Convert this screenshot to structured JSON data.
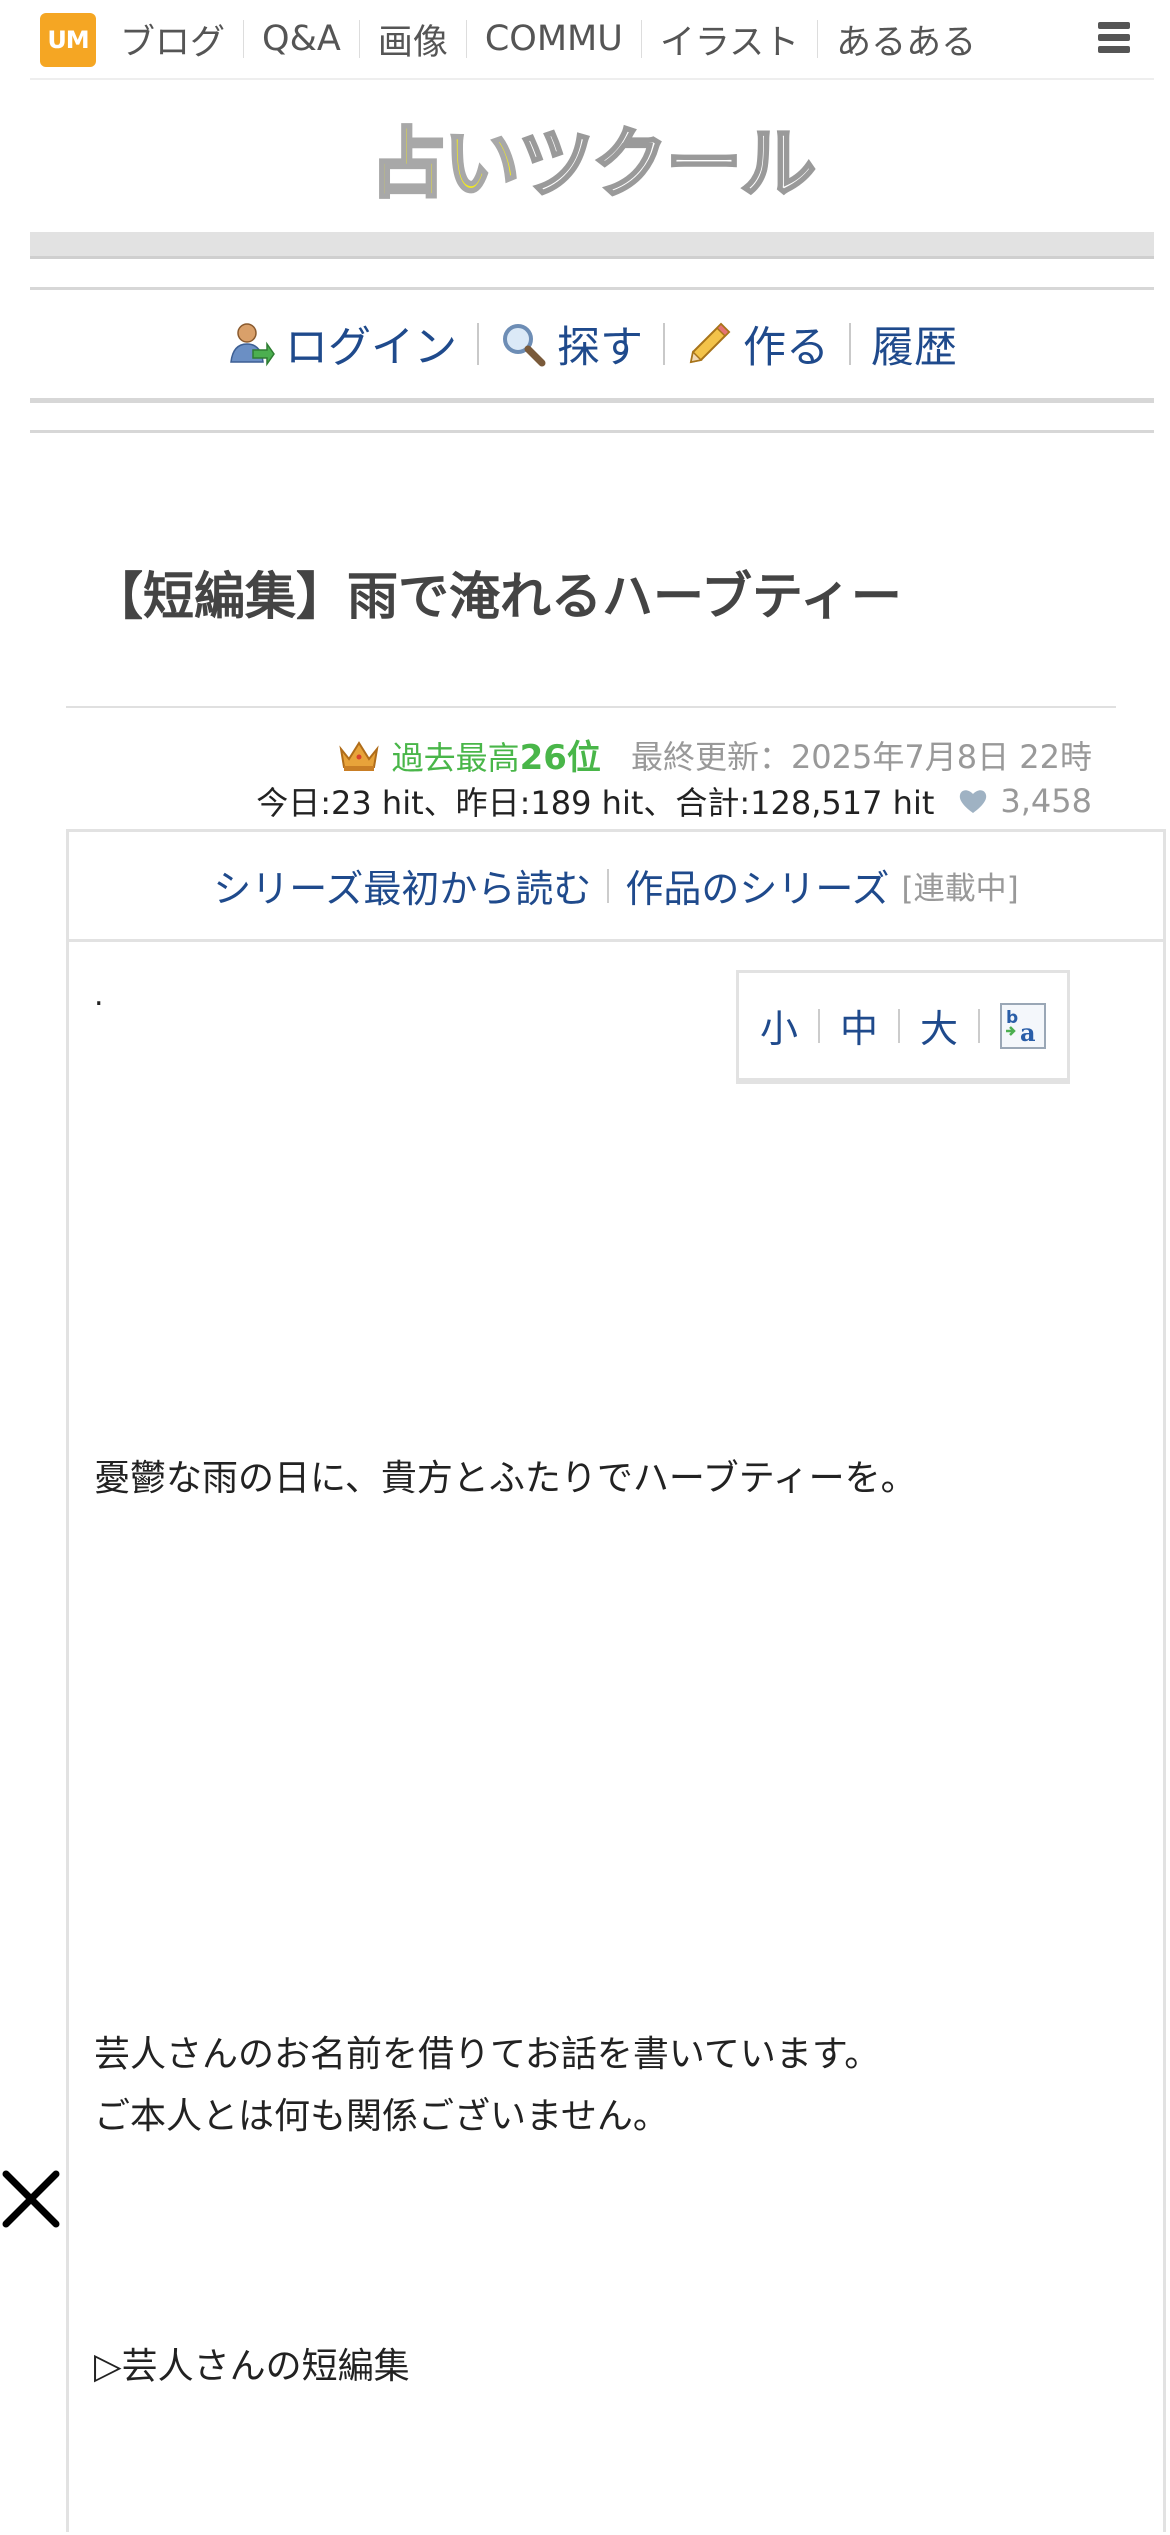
{
  "topnav": {
    "logo_text": "UM",
    "links": [
      "ブログ",
      "Q&A",
      "画像",
      "COMMU",
      "イラスト",
      "あるある"
    ]
  },
  "header": {
    "logo_part1": "占い",
    "logo_part2": "ツクール"
  },
  "account_menu": {
    "login": "ログイン",
    "search": "探す",
    "create": "作る",
    "history": "履歴"
  },
  "article": {
    "title": "【短編集】雨で淹れるハーブティー",
    "rank_prefix": "過去最高",
    "rank_value": "26位",
    "updated": "最終更新：2025年7月8日 22時",
    "hits": "今日:23 hit、昨日:189 hit、合計:128,517 hit",
    "likes": "3,458"
  },
  "series": {
    "read_from_start": "シリーズ最初から読む",
    "series_link": "作品のシリーズ",
    "status": "[連載中]"
  },
  "fontsize": {
    "small": "小",
    "medium": "中",
    "large": "大"
  },
  "body": {
    "dot": ".",
    "intro": "憂鬱な雨の日に、貴方とふたりでハーブティーを。",
    "disclaimer_1": "芸人さんのお名前を借りてお話を書いています。",
    "disclaimer_2": "ご本人とは何も関係ございません。",
    "series_list": "▷芸人さんの短編集"
  },
  "colors": {
    "link": "#1f4a8c",
    "rank_green": "#49b649",
    "muted": "#999999",
    "um_orange": "#f5a623",
    "logo_yellow": "#f2ea1f"
  }
}
